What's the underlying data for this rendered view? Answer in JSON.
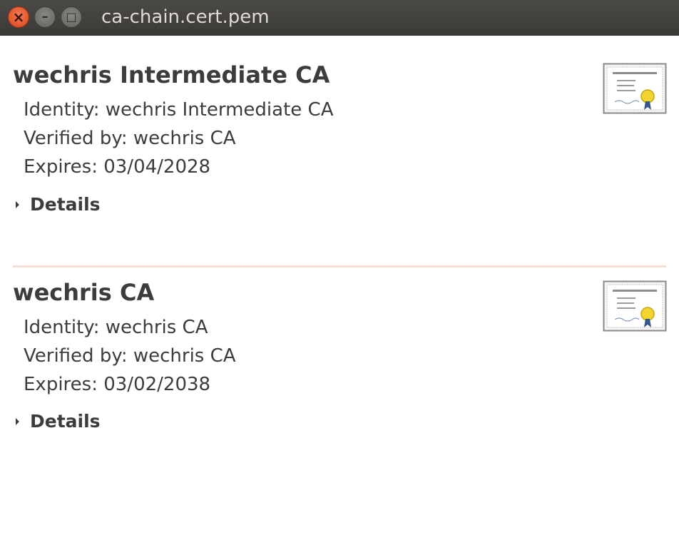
{
  "window": {
    "title": "ca-chain.cert.pem",
    "close_glyph": "×",
    "minimize_glyph": "–",
    "maximize_glyph": "□"
  },
  "certificates": [
    {
      "name": "wechris Intermediate CA",
      "identity": "Identity: wechris Intermediate CA",
      "verified_by": "Verified by: wechris CA",
      "expires": "Expires: 03/04/2028",
      "details_label": "Details",
      "icon": "certificate-icon"
    },
    {
      "name": "wechris CA",
      "identity": "Identity: wechris CA",
      "verified_by": "Verified by: wechris CA",
      "expires": "Expires: 03/02/2038",
      "details_label": "Details",
      "icon": "certificate-icon"
    }
  ],
  "colors": {
    "titlebar": "#3b3a37",
    "close_button": "#e05a2b",
    "divider": "#f4e0d2",
    "text": "#3c3c3c"
  }
}
